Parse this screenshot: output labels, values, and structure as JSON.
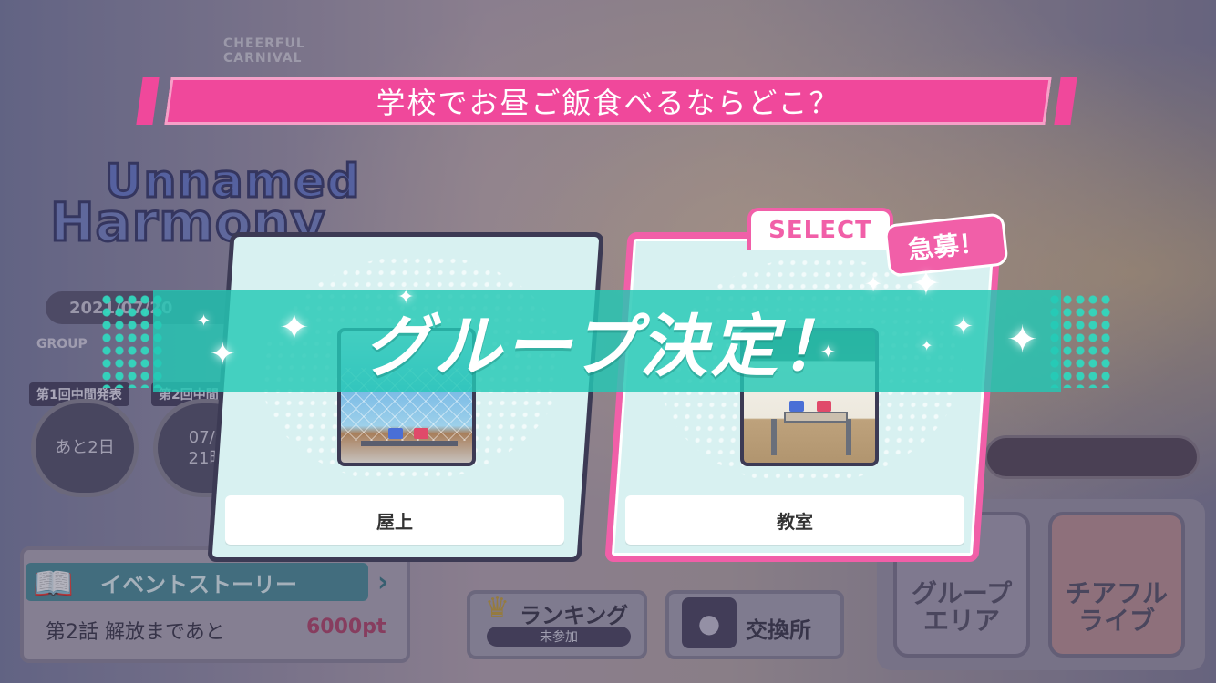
{
  "question": "学校でお昼ご飯食べるならどこ？",
  "result_banner": "グループ決定！",
  "options": [
    {
      "label": "屋上",
      "scene": "rooftop-scene"
    },
    {
      "label": "教室",
      "scene": "classroom-scene",
      "selected": true,
      "select_tag": "SELECT",
      "badge": "急募！"
    }
  ],
  "background": {
    "brand": "CHEERFUL CARNIVAL",
    "event_title_1": "Unnamed",
    "event_title_2": "Harmony",
    "date": "2021/07/20",
    "group_label": "GROUP",
    "tags": [
      "第1回中間発表",
      "第2回中間"
    ],
    "circles": [
      "あと2日",
      "07/0\n21時"
    ],
    "story_title": "イベントストーリー",
    "story_text": "第2話 解放まであと",
    "story_points": "6000pt",
    "ranking_label": "ランキング",
    "ranking_status": "未参加",
    "exchange_label": "交換所",
    "group_area_label": "グループ\nエリア",
    "cheerful_live_label": "チアフル\nライブ"
  },
  "colors": {
    "accent_pink": "#f0489b",
    "teal_banner": "#23c8b4",
    "card_bg": "#d8f1f1",
    "dark_outline": "#3c3a54"
  }
}
